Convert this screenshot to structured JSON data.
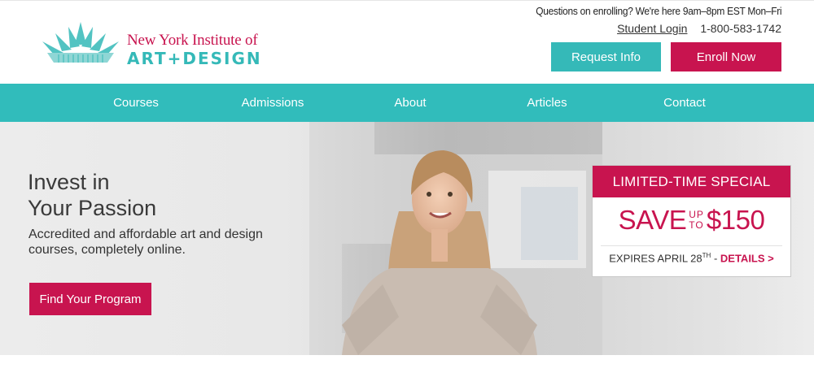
{
  "brand": {
    "line1": "New York Institute of",
    "line2": "ART+DESIGN",
    "accent_teal": "#35b9b8",
    "accent_magenta": "#c8144f"
  },
  "header": {
    "note": "Questions on enrolling? We're here 9am–8pm EST Mon–Fri",
    "student_login": "Student Login",
    "phone": "1-800-583-1742",
    "request_info": "Request Info",
    "enroll_now": "Enroll Now"
  },
  "nav": {
    "items": [
      "Courses",
      "Admissions",
      "About",
      "Articles",
      "Contact"
    ]
  },
  "hero": {
    "title_line1": "Invest in",
    "title_line2": "Your Passion",
    "subtitle": "Accredited and affordable art and design courses, completely online.",
    "cta": "Find Your Program"
  },
  "promo": {
    "heading": "LIMITED-TIME SPECIAL",
    "save": "SAVE",
    "up": "UP",
    "to": "TO",
    "amount": "$150",
    "expires": "EXPIRES APRIL 28",
    "expires_suffix": "TH",
    "separator": " - ",
    "details": "DETAILS >"
  }
}
